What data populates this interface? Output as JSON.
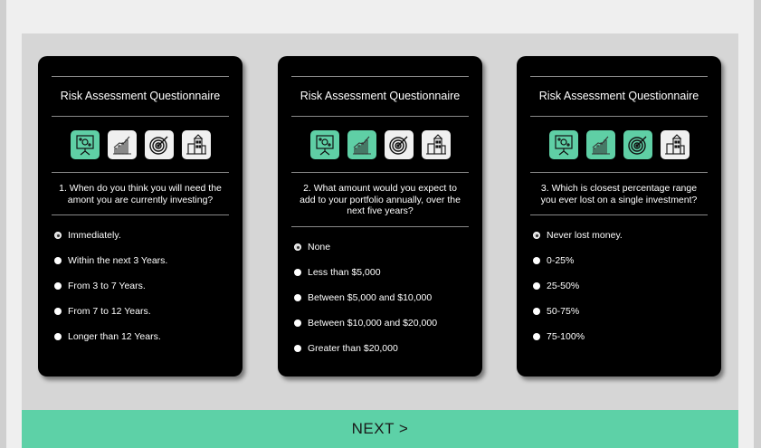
{
  "cards": [
    {
      "title": "Risk Assessment Questionnaire",
      "question": "1. When do you think you will need the amont you are currently investing?",
      "icons": [
        {
          "name": "presentation-board-icon",
          "active": true
        },
        {
          "name": "growth-chart-icon",
          "active": false
        },
        {
          "name": "target-icon",
          "active": false
        },
        {
          "name": "buildings-icon",
          "active": false
        }
      ],
      "selected_index": 0,
      "options": [
        "Immediately.",
        "Within the next 3 Years.",
        "From 3 to 7 Years.",
        "From 7 to 12 Years.",
        "Longer than 12 Years."
      ]
    },
    {
      "title": "Risk Assessment Questionnaire",
      "question": "2. What amount would you expect to add to your portfolio annually, over the next five years?",
      "icons": [
        {
          "name": "presentation-board-icon",
          "active": true
        },
        {
          "name": "growth-chart-icon",
          "active": true
        },
        {
          "name": "target-icon",
          "active": false
        },
        {
          "name": "buildings-icon",
          "active": false
        }
      ],
      "selected_index": 0,
      "options": [
        "None",
        "Less than $5,000",
        "Between $5,000 and $10,000",
        "Between $10,000 and $20,000",
        "Greater than $20,000"
      ]
    },
    {
      "title": "Risk Assessment Questionnaire",
      "question": "3. Which is closest percentage range you ever lost on a single investment?",
      "icons": [
        {
          "name": "presentation-board-icon",
          "active": true
        },
        {
          "name": "growth-chart-icon",
          "active": true
        },
        {
          "name": "target-icon",
          "active": true
        },
        {
          "name": "buildings-icon",
          "active": false
        }
      ],
      "selected_index": 0,
      "options": [
        "Never lost money.",
        "0-25%",
        "25-50%",
        "50-75%",
        "75-100%"
      ]
    }
  ],
  "next_label": "NEXT >",
  "colors": {
    "accent": "#5dd1a7",
    "card_bg": "#000000",
    "stage_bg": "#d6d6d6"
  }
}
